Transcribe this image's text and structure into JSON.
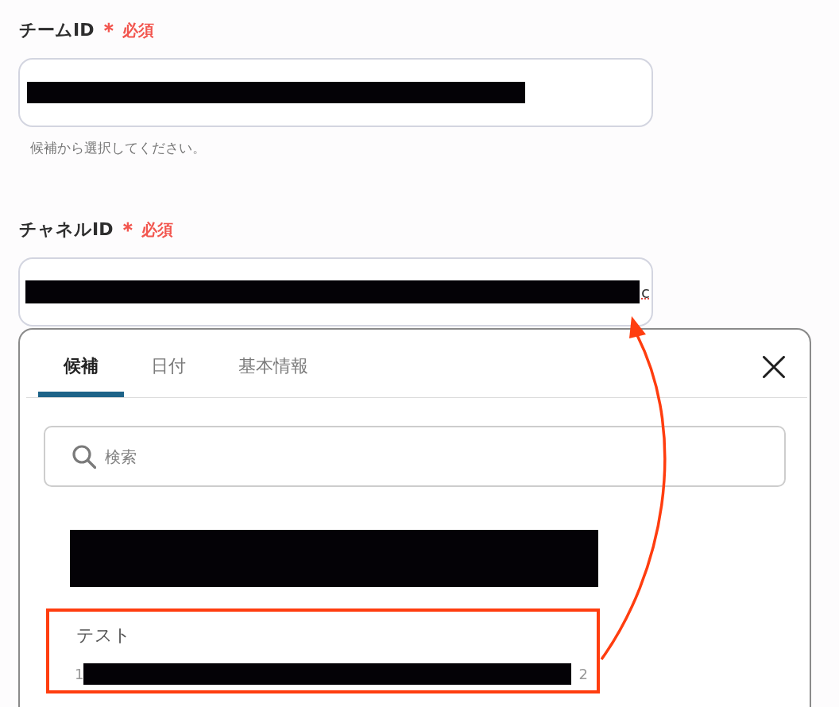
{
  "fields": [
    {
      "label": "チームID",
      "required_mark": "＊",
      "required_text": "必須",
      "value_redacted": true,
      "hint": "候補から選択してください。"
    },
    {
      "label": "チャネルID",
      "required_mark": "＊",
      "required_text": "必須",
      "value_redacted": true,
      "value_tail": "c"
    }
  ],
  "picker": {
    "tabs": [
      {
        "label": "候補",
        "selected": true
      },
      {
        "label": "日付",
        "selected": false
      },
      {
        "label": "基本情報",
        "selected": false
      }
    ],
    "search": {
      "placeholder": "検索"
    },
    "items": [
      {
        "redacted": true,
        "highlighted": false
      },
      {
        "title": "テスト",
        "id_head": "1",
        "id_redacted": true,
        "id_tail": "2",
        "highlighted": true
      }
    ]
  }
}
